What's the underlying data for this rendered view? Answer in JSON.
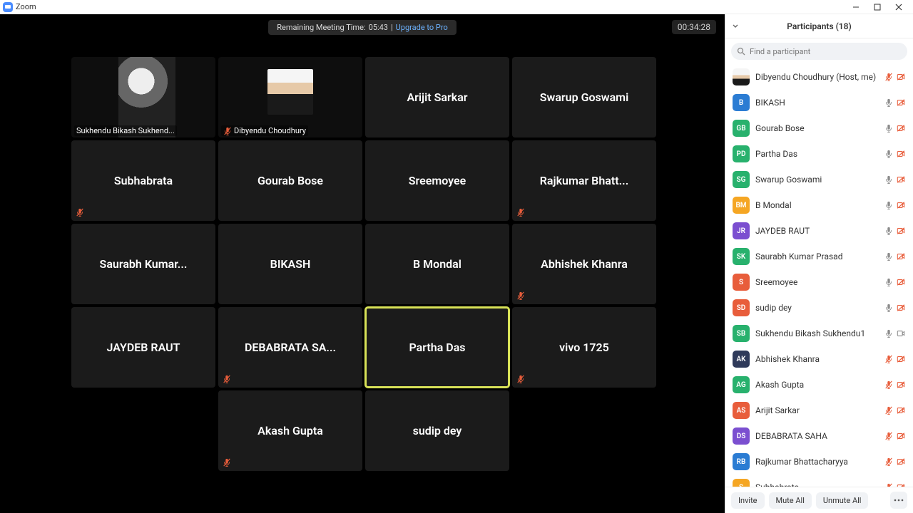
{
  "titlebar": {
    "app_name": "Zoom"
  },
  "meeting": {
    "banner_prefix": "Remaining Meeting Time: ",
    "remaining_time": "05:43",
    "banner_separator": " | ",
    "upgrade_label": "Upgrade to Pro",
    "elapsed_time": "00:34:28"
  },
  "tiles": [
    {
      "name": "Sukhendu Bikash Sukhend...",
      "label_style": "bl",
      "muted": false,
      "video": true
    },
    {
      "name": "Dibyendu Choudhury",
      "label_style": "bl",
      "muted": true,
      "video": true
    },
    {
      "name": "Arijit Sarkar",
      "label_style": "center",
      "muted": false
    },
    {
      "name": "Swarup Goswami",
      "label_style": "center",
      "muted": false
    },
    {
      "name": "Subhabrata",
      "label_style": "center",
      "muted": true
    },
    {
      "name": "Gourab Bose",
      "label_style": "center",
      "muted": false
    },
    {
      "name": "Sreemoyee",
      "label_style": "center",
      "muted": false
    },
    {
      "name": "Rajkumar  Bhatt...",
      "label_style": "center",
      "muted": true
    },
    {
      "name": "Saurabh  Kumar...",
      "label_style": "center",
      "muted": false
    },
    {
      "name": "BIKASH",
      "label_style": "center",
      "muted": false
    },
    {
      "name": "B Mondal",
      "label_style": "center",
      "muted": false
    },
    {
      "name": "Abhishek Khanra",
      "label_style": "center",
      "muted": true
    },
    {
      "name": "JAYDEB RAUT",
      "label_style": "center",
      "muted": false
    },
    {
      "name": "DEBABRATA  SA...",
      "label_style": "center",
      "muted": true
    },
    {
      "name": "Partha Das",
      "label_style": "center",
      "muted": false,
      "speaking": true
    },
    {
      "name": "vivo 1725",
      "label_style": "center",
      "muted": true
    },
    {
      "name": "Akash Gupta",
      "label_style": "center",
      "muted": true,
      "col_start": 2
    },
    {
      "name": "sudip dey",
      "label_style": "center",
      "muted": false
    }
  ],
  "participants": {
    "title": "Participants (18)",
    "search_placeholder": "Find a participant",
    "list": [
      {
        "name": "Dibyendu Choudhury (Host, me)",
        "avatar": "img",
        "color": "",
        "mic": "muted",
        "cam": "off"
      },
      {
        "name": "BIKASH",
        "avatar": "B",
        "color": "#2b7cd3",
        "mic": "on",
        "cam": "off"
      },
      {
        "name": "Gourab Bose",
        "avatar": "GB",
        "color": "#28b16d",
        "mic": "on",
        "cam": "off"
      },
      {
        "name": "Partha Das",
        "avatar": "PD",
        "color": "#28b16d",
        "mic": "on",
        "cam": "off"
      },
      {
        "name": "Swarup Goswami",
        "avatar": "SG",
        "color": "#28b16d",
        "mic": "on",
        "cam": "off"
      },
      {
        "name": "B Mondal",
        "avatar": "BM",
        "color": "#f5a623",
        "mic": "on",
        "cam": "off"
      },
      {
        "name": "JAYDEB RAUT",
        "avatar": "JR",
        "color": "#7b4fd0",
        "mic": "on",
        "cam": "off"
      },
      {
        "name": "Saurabh Kumar Prasad",
        "avatar": "SK",
        "color": "#28b16d",
        "mic": "on",
        "cam": "off"
      },
      {
        "name": "Sreemoyee",
        "avatar": "S",
        "color": "#e85d3b",
        "mic": "on",
        "cam": "off"
      },
      {
        "name": "sudip dey",
        "avatar": "SD",
        "color": "#e85d3b",
        "mic": "on",
        "cam": "off"
      },
      {
        "name": "Sukhendu Bikash Sukhendu1",
        "avatar": "SB",
        "color": "#28b16d",
        "mic": "on",
        "cam": "on"
      },
      {
        "name": "Abhishek Khanra",
        "avatar": "AK",
        "color": "#2f3a5a",
        "mic": "muted",
        "cam": "off"
      },
      {
        "name": "Akash Gupta",
        "avatar": "AG",
        "color": "#28b16d",
        "mic": "muted",
        "cam": "off"
      },
      {
        "name": "Arijit Sarkar",
        "avatar": "AS",
        "color": "#e85d3b",
        "mic": "muted",
        "cam": "off"
      },
      {
        "name": "DEBABRATA SAHA",
        "avatar": "DS",
        "color": "#7b4fd0",
        "mic": "muted",
        "cam": "off"
      },
      {
        "name": "Rajkumar Bhattacharyya",
        "avatar": "RB",
        "color": "#2b7cd3",
        "mic": "muted",
        "cam": "off"
      },
      {
        "name": "Subhabrata",
        "avatar": "S",
        "color": "#f5a623",
        "mic": "muted",
        "cam": "off"
      }
    ],
    "footer": {
      "invite": "Invite",
      "mute_all": "Mute All",
      "unmute_all": "Unmute All"
    }
  }
}
